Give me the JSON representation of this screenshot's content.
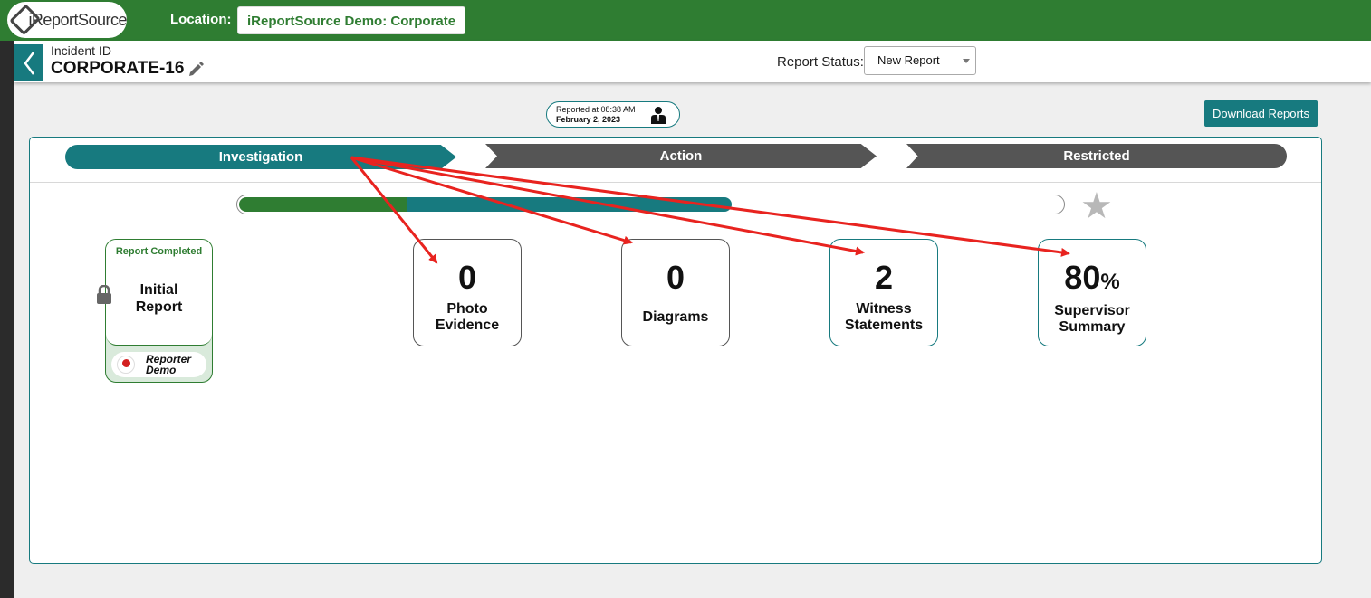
{
  "topbar": {
    "logo_text": "iReportSource",
    "location_label": "Location:",
    "location_value": "iReportSource Demo: Corporate"
  },
  "header": {
    "incident_label": "Incident ID",
    "incident_id": "CORPORATE-16",
    "status_label": "Report Status:",
    "status_value": "New Report"
  },
  "reported": {
    "line1": "Reported at 08:38 AM",
    "line2": "February 2, 2023"
  },
  "download_label": "Download Reports",
  "steps": [
    {
      "label": "Investigation",
      "active": true
    },
    {
      "label": "Action",
      "active": false
    },
    {
      "label": "Restricted",
      "active": false
    }
  ],
  "progress": {
    "percent": 60
  },
  "initial_report": {
    "status": "Report Completed",
    "title_line1": "Initial",
    "title_line2": "Report",
    "reporter_line1": "Reporter",
    "reporter_line2": "Demo"
  },
  "stats": [
    {
      "value": "0",
      "label_line1": "Photo",
      "label_line2": "Evidence"
    },
    {
      "value": "0",
      "label_line1": "Diagrams",
      "label_line2": ""
    },
    {
      "value": "2",
      "label_line1": "Witness",
      "label_line2": "Statements"
    },
    {
      "value": "80",
      "suffix": "%",
      "label_line1": "Supervisor",
      "label_line2": "Summary"
    }
  ],
  "colors": {
    "brand_green": "#2f7d32",
    "teal": "#177a7f",
    "annotation_red": "#e8231f"
  }
}
